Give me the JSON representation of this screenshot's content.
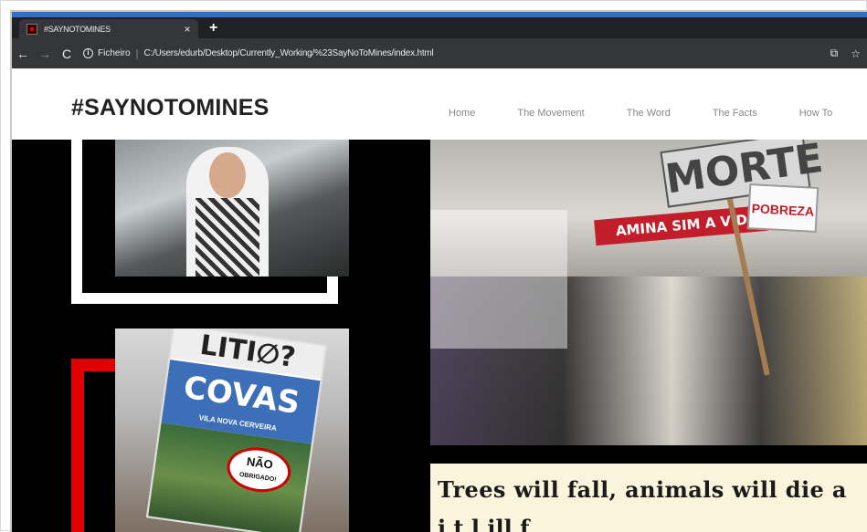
{
  "browser": {
    "tab_title": "#SAYNOTOMINES",
    "tab_close": "×",
    "new_tab": "+",
    "back": "←",
    "forward": "→",
    "reload": "C",
    "scheme_label": "Ficheiro",
    "separator": "|",
    "url": "C:/Users/edurb/Desktop/Currently_Working/%23SayNoToMines/index.html",
    "translate_icon": "⧉",
    "bookmark_icon": "☆"
  },
  "site": {
    "logo": "#SAYNOTOMINES",
    "menu": [
      "Home",
      "The Movement",
      "The Word",
      "The Facts",
      "How To"
    ]
  },
  "images": {
    "sign_top": "LITI∅?",
    "sign_covas": "COVAS",
    "sign_sub": "VILA NOVA CERVEIRA",
    "sign_bubble": "NÃO",
    "sign_bubble_small": "OBRIGADO!",
    "banner": "AMINA SIM A VID",
    "morte": "MORTE",
    "pobreza": "POBREZA"
  },
  "quote": {
    "line1": "Trees will fall, animals will die a",
    "line2": "i    t          l   ill           f"
  },
  "colors": {
    "accent_blue": "#2f6fc4",
    "accent_red": "#e00000",
    "quote_bg": "#fbf4dc"
  }
}
